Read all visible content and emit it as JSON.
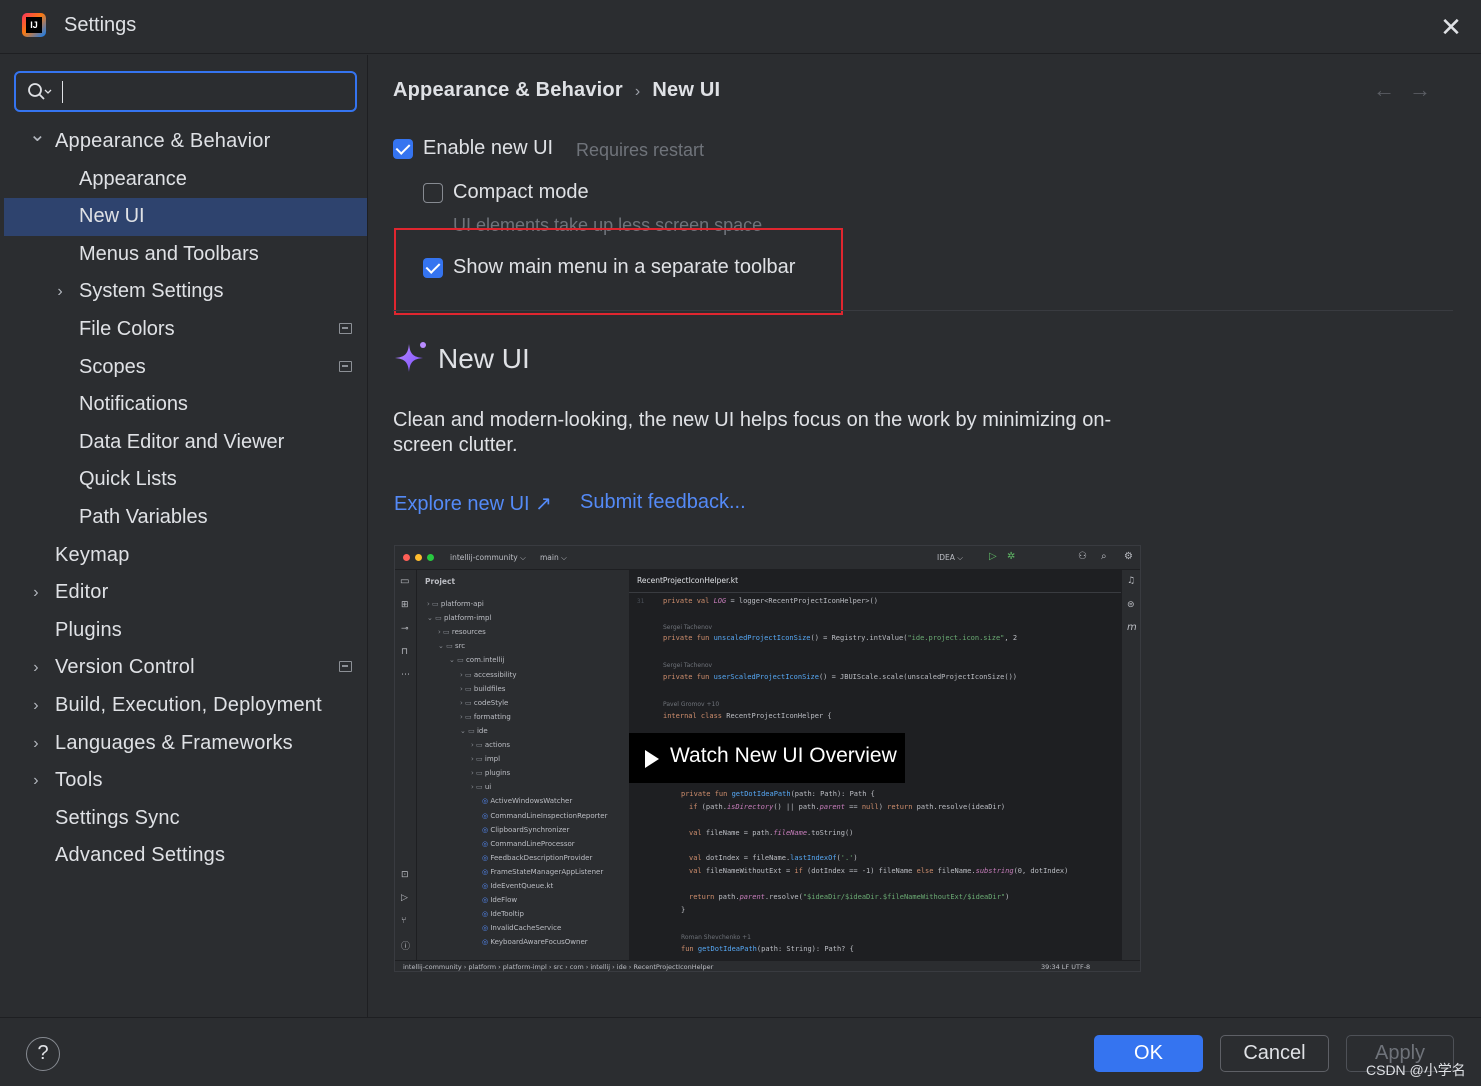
{
  "window": {
    "title": "Settings"
  },
  "search": {
    "placeholder": "",
    "value": ""
  },
  "sidebar": {
    "items": [
      {
        "label": "Appearance & Behavior",
        "level": 0,
        "chevron": "expanded"
      },
      {
        "label": "Appearance",
        "level": 1
      },
      {
        "label": "New UI",
        "level": 1,
        "selected": true
      },
      {
        "label": "Menus and Toolbars",
        "level": 1
      },
      {
        "label": "System Settings",
        "level": 1,
        "chevron": "collapsed"
      },
      {
        "label": "File Colors",
        "level": 1,
        "badge": "project-settings-icon"
      },
      {
        "label": "Scopes",
        "level": 1,
        "badge": "project-settings-icon"
      },
      {
        "label": "Notifications",
        "level": 1
      },
      {
        "label": "Data Editor and Viewer",
        "level": 1
      },
      {
        "label": "Quick Lists",
        "level": 1
      },
      {
        "label": "Path Variables",
        "level": 1
      },
      {
        "label": "Keymap",
        "level": 0
      },
      {
        "label": "Editor",
        "level": 0,
        "chevron": "collapsed"
      },
      {
        "label": "Plugins",
        "level": 0
      },
      {
        "label": "Version Control",
        "level": 0,
        "chevron": "collapsed",
        "badge": "project-settings-icon"
      },
      {
        "label": "Build, Execution, Deployment",
        "level": 0,
        "chevron": "collapsed"
      },
      {
        "label": "Languages & Frameworks",
        "level": 0,
        "chevron": "collapsed"
      },
      {
        "label": "Tools",
        "level": 0,
        "chevron": "collapsed"
      },
      {
        "label": "Settings Sync",
        "level": 0
      },
      {
        "label": "Advanced Settings",
        "level": 0
      }
    ]
  },
  "breadcrumb": {
    "parent": "Appearance & Behavior",
    "separator": "›",
    "current": "New UI"
  },
  "nav": {
    "back": "←",
    "forward": "→"
  },
  "options": {
    "enable_new_ui": {
      "label": "Enable new UI",
      "checked": true,
      "hint": "Requires restart"
    },
    "compact_mode": {
      "label": "Compact mode",
      "checked": false,
      "hint": "UI elements take up less screen space"
    },
    "separate_toolbar": {
      "label": "Show main menu in a separate toolbar",
      "checked": true
    }
  },
  "promo": {
    "title": "New UI",
    "description": "Clean and modern-looking, the new UI helps focus on the work by minimizing on-screen clutter.",
    "explore_link": "Explore new UI ↗",
    "feedback_link": "Submit feedback..."
  },
  "preview": {
    "play_label": "Watch New UI Overview",
    "toolbar": {
      "project": "intellij-community ⌵",
      "branch": "main ⌵",
      "run_config": "IDEA ⌵"
    },
    "project_header": "Project",
    "editor_tab": "RecentProjectIconHelper.kt",
    "tree": [
      "platform-api",
      "platform-impl",
      "resources",
      "src",
      "com.intellij",
      "accessibility",
      "buildfiles",
      "codeStyle",
      "formatting",
      "ide",
      "actions",
      "impl",
      "plugins",
      "ui",
      "ActiveWindowsWatcher",
      "CommandLineInspectionReporter",
      "ClipboardSynchronizer",
      "CommandLineProcessor",
      "FeedbackDescriptionProvider",
      "FrameStateManagerAppListener",
      "IdeEventQueue.kt",
      "IdeFlow",
      "IdeTooltip",
      "InvalidCacheService",
      "KeyboardAwareFocusOwner"
    ],
    "status_path": "intellij-community  ›  platform  ›  platform-impl  ›  src  ›  com  ›  intellij  ›  ide  ›  RecentProjectIconHelper",
    "status_right": "39:34    LF    UTF-8"
  },
  "buttons": {
    "ok": "OK",
    "cancel": "Cancel",
    "apply": "Apply",
    "help": "?"
  },
  "watermark": "CSDN @小学名",
  "colors": {
    "accent": "#3574f0",
    "selection": "#2e436e",
    "link": "#548af7",
    "highlight_box": "#e0262f"
  }
}
